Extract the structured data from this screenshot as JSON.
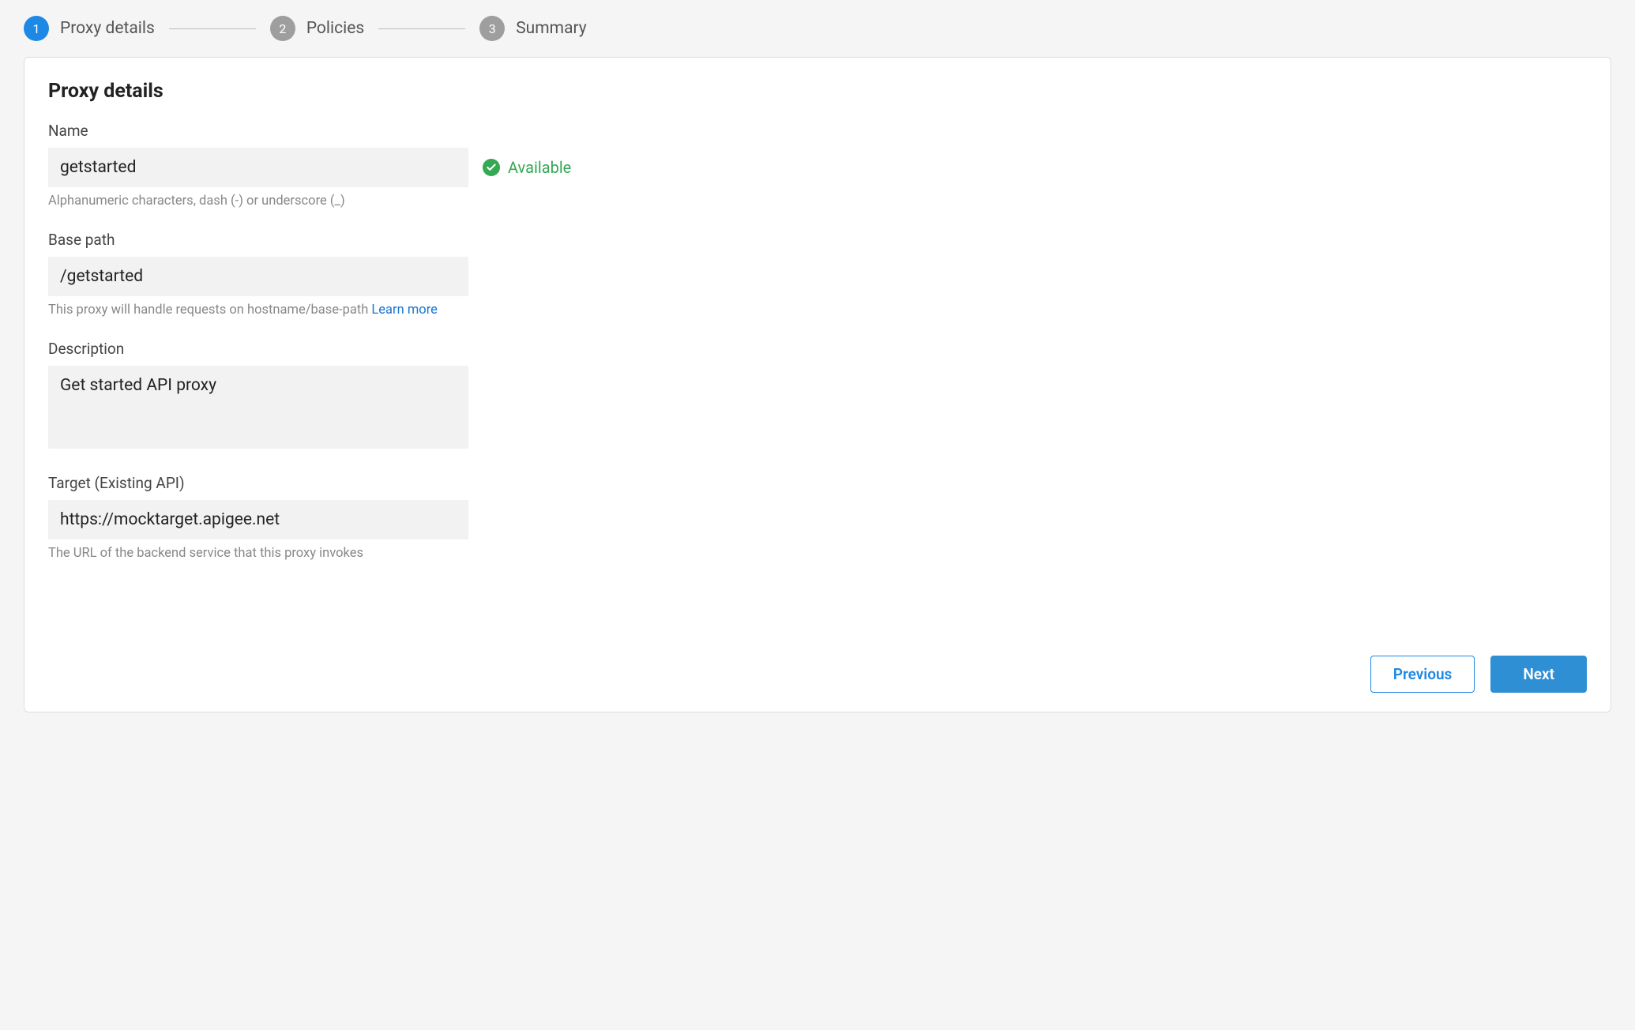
{
  "stepper": {
    "steps": [
      {
        "number": "1",
        "label": "Proxy details",
        "active": true
      },
      {
        "number": "2",
        "label": "Policies",
        "active": false
      },
      {
        "number": "3",
        "label": "Summary",
        "active": false
      }
    ]
  },
  "panel": {
    "title": "Proxy details"
  },
  "form": {
    "name": {
      "label": "Name",
      "value": "getstarted",
      "hint": "Alphanumeric characters, dash (-) or underscore (_)",
      "availability_text": "Available"
    },
    "basepath": {
      "label": "Base path",
      "value": "/getstarted",
      "hint_prefix": "This proxy will handle requests on hostname/base-path ",
      "hint_link": "Learn more"
    },
    "description": {
      "label": "Description",
      "value": "Get started API proxy"
    },
    "target": {
      "label": "Target (Existing API)",
      "value": "https://mocktarget.apigee.net",
      "hint": "The URL of the backend service that this proxy invokes"
    }
  },
  "buttons": {
    "previous": "Previous",
    "next": "Next"
  }
}
